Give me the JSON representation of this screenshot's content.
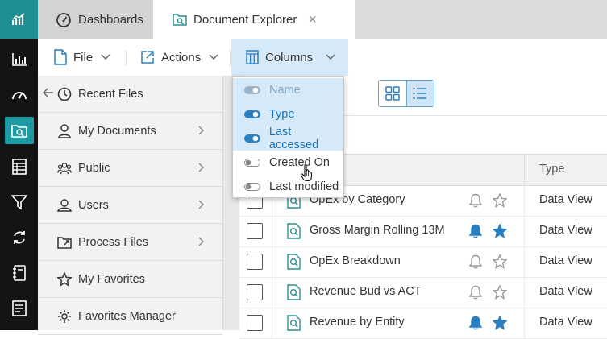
{
  "tabs": [
    {
      "label": "Dashboards",
      "icon": "dashboard-gauge-icon"
    },
    {
      "label": "Document Explorer",
      "icon": "document-explorer-icon",
      "close": "×"
    }
  ],
  "toolbar": {
    "file_label": "File",
    "actions_label": "Actions",
    "columns_label": "Columns"
  },
  "rail": [
    "analytics-logo-icon",
    "bar-chart-icon",
    "gauge-icon",
    "document-explorer-icon",
    "spreadsheet-icon",
    "filter-icon",
    "refresh-cycle-icon",
    "notebook-icon",
    "report-icon"
  ],
  "nav": {
    "items": [
      {
        "label": "Recent Files",
        "icon": "clock-icon",
        "chevron": false
      },
      {
        "label": "My Documents",
        "icon": "user-icon",
        "chevron": true
      },
      {
        "label": "Public",
        "icon": "group-icon",
        "chevron": true
      },
      {
        "label": "Users",
        "icon": "users-icon",
        "chevron": true
      },
      {
        "label": "Process Files",
        "icon": "folder-share-icon",
        "chevron": true
      },
      {
        "label": "My Favorites",
        "icon": "star-icon",
        "chevron": false
      },
      {
        "label": "Favorites Manager",
        "icon": "gear-icon",
        "chevron": false
      }
    ]
  },
  "columns_menu": {
    "options": [
      {
        "label": "Name",
        "on": true,
        "disabled": true
      },
      {
        "label": "Type",
        "on": true,
        "disabled": false
      },
      {
        "label": "Last accessed",
        "on": true,
        "disabled": false
      },
      {
        "label": "Created On",
        "on": false,
        "disabled": false
      },
      {
        "label": "Last modified",
        "on": false,
        "disabled": false
      }
    ]
  },
  "table": {
    "header_type": "Type",
    "rows": [
      {
        "name": "OpEx by Category",
        "type": "Data View",
        "subscribed": false,
        "favorite": false
      },
      {
        "name": "Gross Margin Rolling 13M",
        "type": "Data View",
        "subscribed": true,
        "favorite": true
      },
      {
        "name": "OpEx Breakdown",
        "type": "Data View",
        "subscribed": false,
        "favorite": false
      },
      {
        "name": "Revenue Bud vs ACT",
        "type": "Data View",
        "subscribed": false,
        "favorite": false
      },
      {
        "name": "Revenue by Entity",
        "type": "Data View",
        "subscribed": true,
        "favorite": true
      }
    ]
  },
  "colors": {
    "accent": "#1f9ca3",
    "selection": "#d6e9f8",
    "link_blue": "#1b73b5",
    "icon_teal": "#2a8f95"
  }
}
